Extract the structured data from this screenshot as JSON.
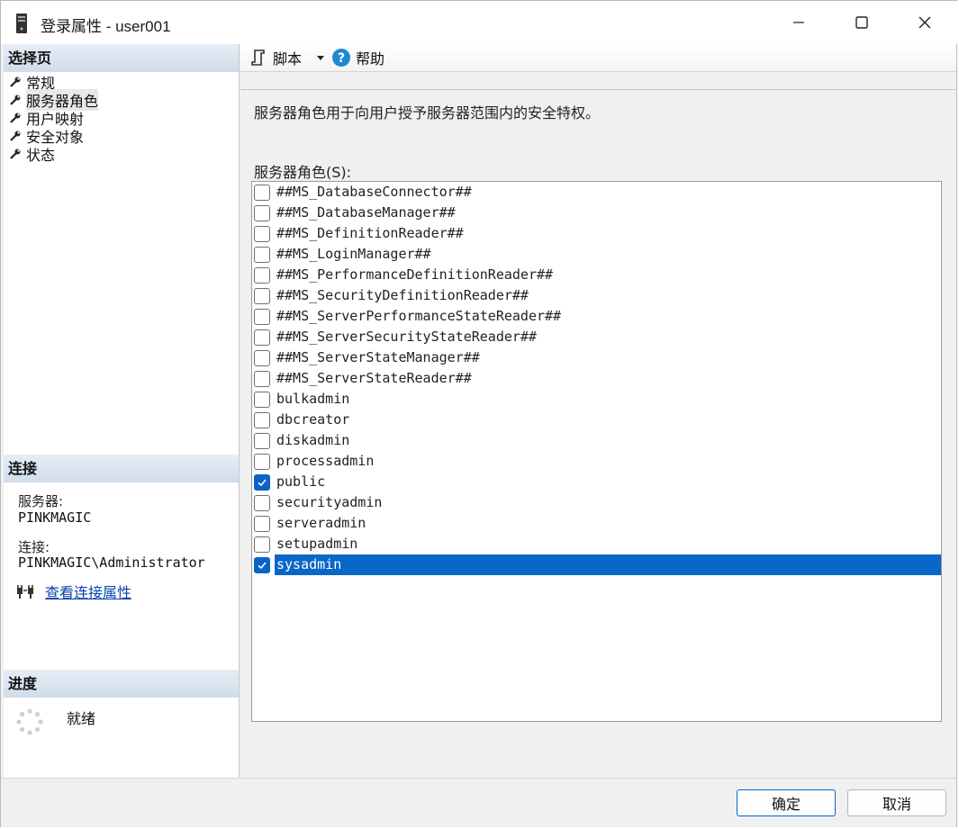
{
  "window": {
    "title": "登录属性 - user001"
  },
  "left": {
    "select_page_header": "选择页",
    "nav_items": [
      {
        "label": "常规"
      },
      {
        "label": "服务器角色"
      },
      {
        "label": "用户映射"
      },
      {
        "label": "安全对象"
      },
      {
        "label": "状态"
      }
    ],
    "connection_header": "连接",
    "server_label": "服务器:",
    "server_value": "PINKMAGIC",
    "connection_label": "连接:",
    "connection_value": "PINKMAGIC\\Administrator",
    "view_connection_link": "查看连接属性",
    "progress_header": "进度",
    "progress_status": "就绪"
  },
  "toolbar": {
    "script_label": "脚本",
    "help_label": "帮助"
  },
  "main": {
    "description": "服务器角色用于向用户授予服务器范围内的安全特权。",
    "roles_label": "服务器角色(S):",
    "roles": [
      {
        "name": "##MS_DatabaseConnector##",
        "checked": false
      },
      {
        "name": "##MS_DatabaseManager##",
        "checked": false
      },
      {
        "name": "##MS_DefinitionReader##",
        "checked": false
      },
      {
        "name": "##MS_LoginManager##",
        "checked": false
      },
      {
        "name": "##MS_PerformanceDefinitionReader##",
        "checked": false
      },
      {
        "name": "##MS_SecurityDefinitionReader##",
        "checked": false
      },
      {
        "name": "##MS_ServerPerformanceStateReader##",
        "checked": false
      },
      {
        "name": "##MS_ServerSecurityStateReader##",
        "checked": false
      },
      {
        "name": "##MS_ServerStateManager##",
        "checked": false
      },
      {
        "name": "##MS_ServerStateReader##",
        "checked": false
      },
      {
        "name": "bulkadmin",
        "checked": false
      },
      {
        "name": "dbcreator",
        "checked": false
      },
      {
        "name": "diskadmin",
        "checked": false
      },
      {
        "name": "processadmin",
        "checked": false
      },
      {
        "name": "public",
        "checked": true
      },
      {
        "name": "securityadmin",
        "checked": false
      },
      {
        "name": "serveradmin",
        "checked": false
      },
      {
        "name": "setupadmin",
        "checked": false
      },
      {
        "name": "sysadmin",
        "checked": true
      }
    ]
  },
  "footer": {
    "ok_label": "确定",
    "cancel_label": "取消"
  },
  "colors": {
    "selection": "#0a66c8",
    "link": "#0645ad",
    "header_bg": "#cfdcea"
  }
}
